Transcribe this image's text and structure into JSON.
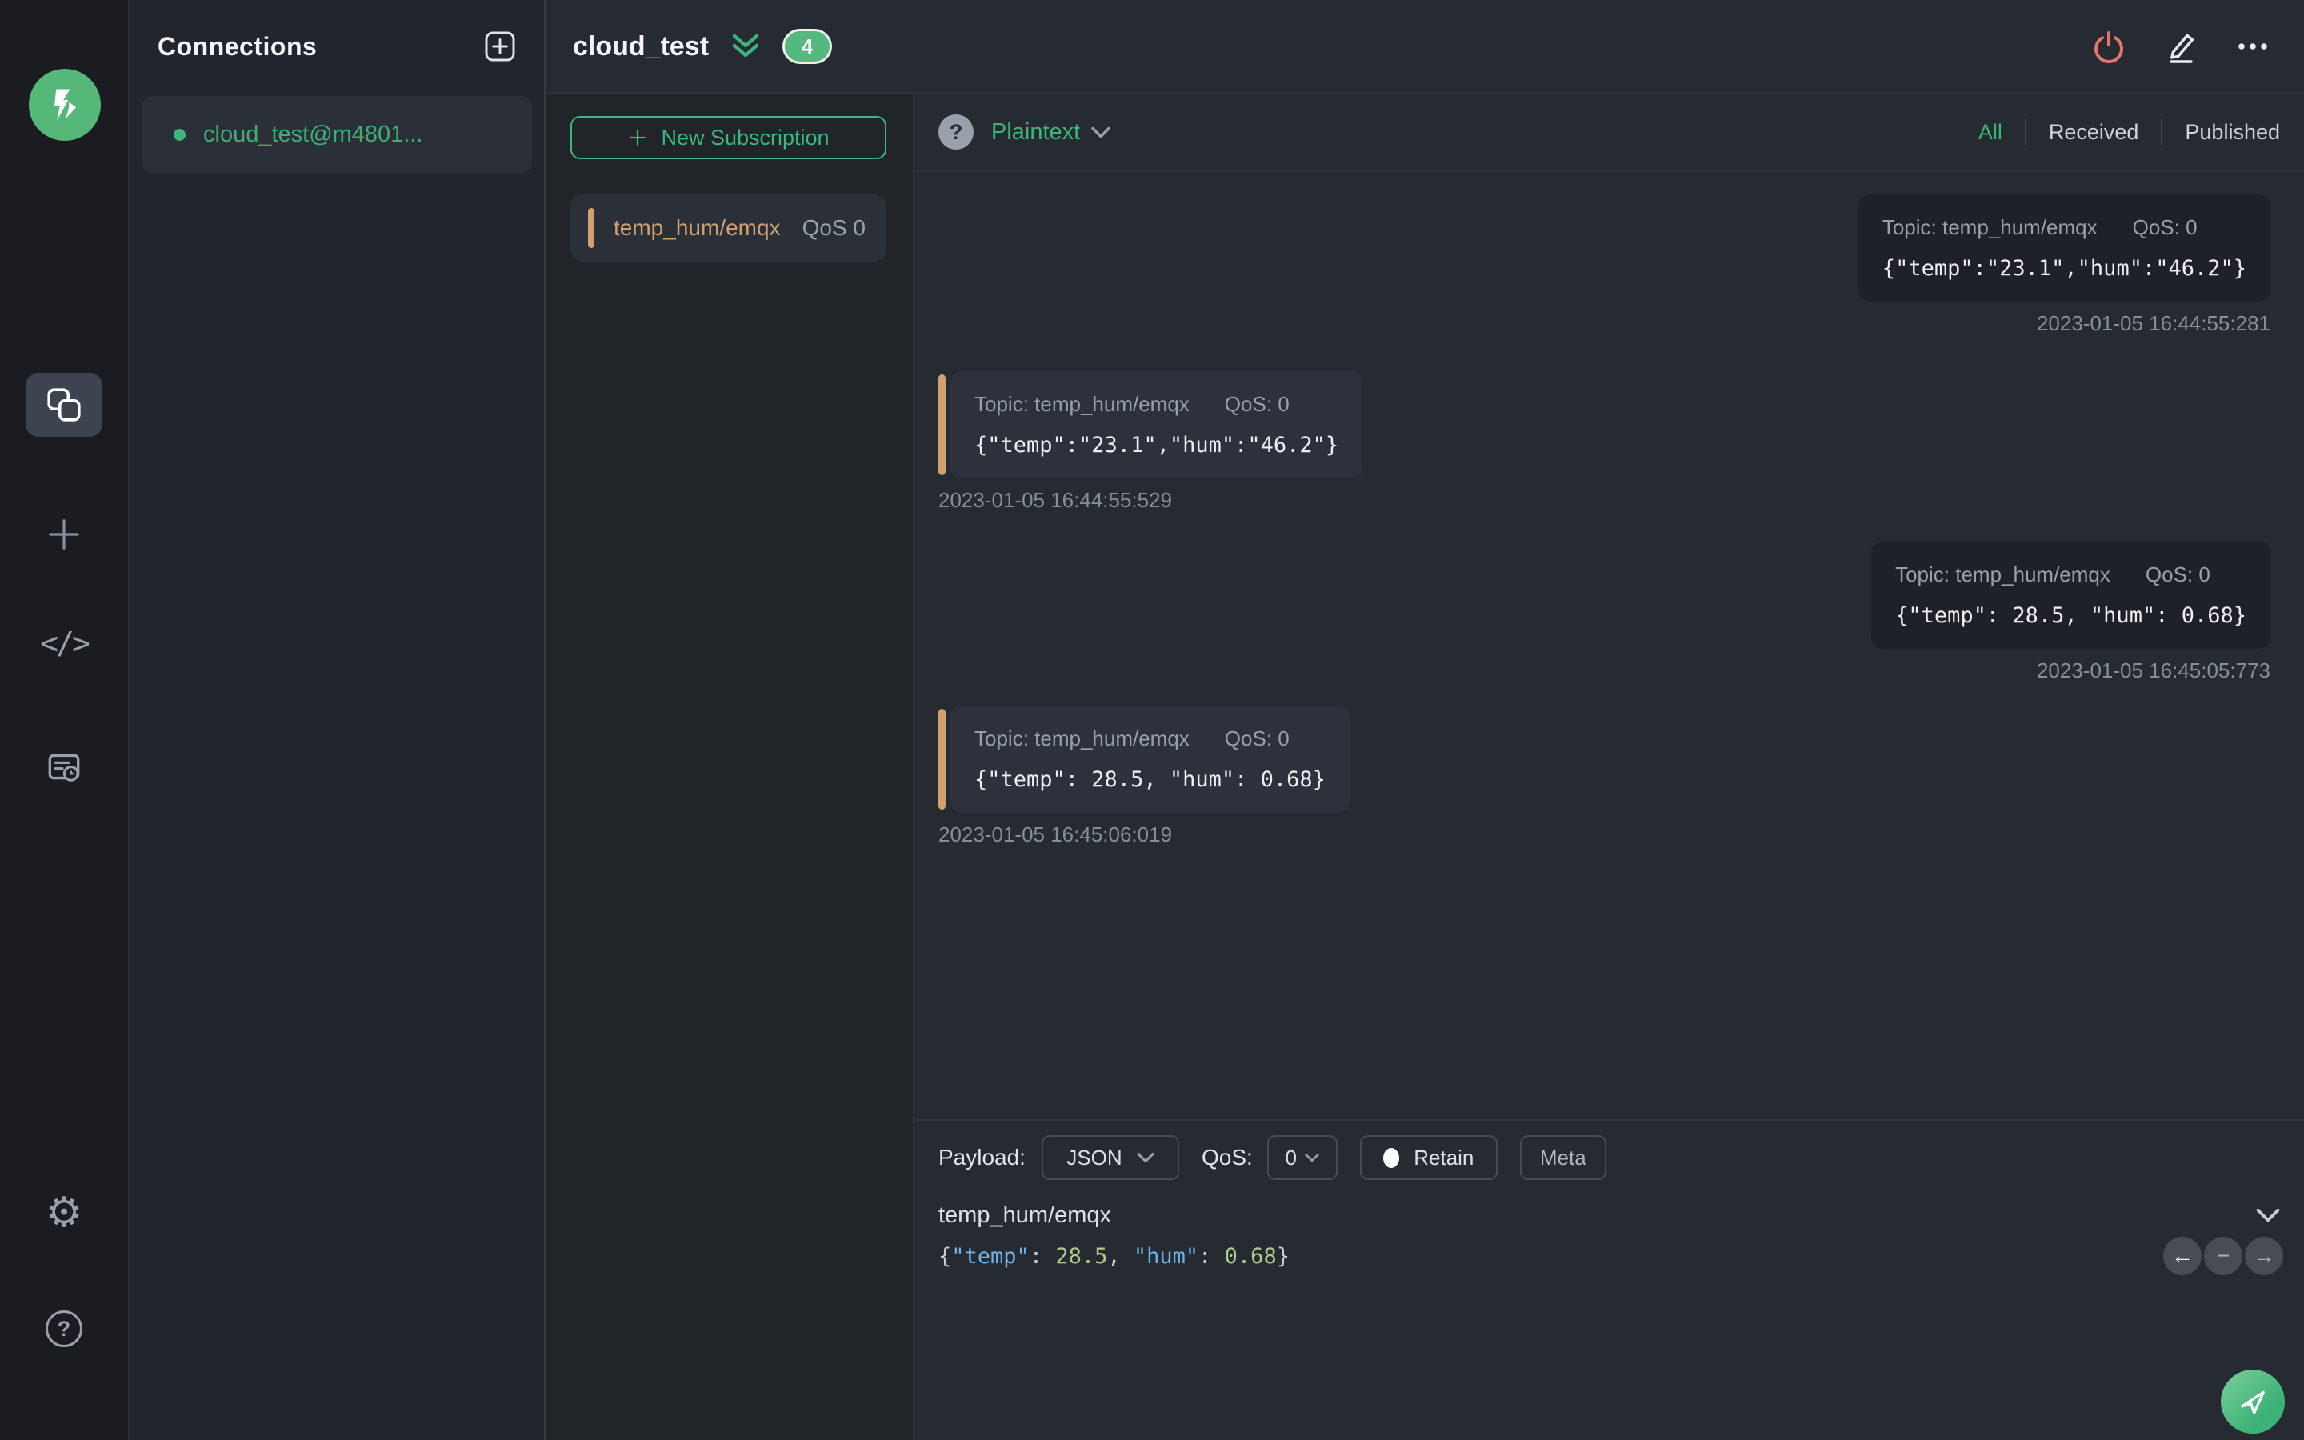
{
  "sidebar": {
    "logo_alt": "MQTTX",
    "nav": [
      {
        "name": "connections",
        "active": true
      },
      {
        "name": "new-connection",
        "active": false
      },
      {
        "name": "script",
        "active": false
      },
      {
        "name": "log",
        "active": false
      }
    ],
    "script_glyph": "</>",
    "gear_glyph": "⚙",
    "help_glyph": "?",
    "bottom": [
      {
        "name": "settings"
      },
      {
        "name": "help"
      }
    ]
  },
  "connections": {
    "title": "Connections",
    "items": [
      {
        "label": "cloud_test@m4801...",
        "connected": true
      }
    ]
  },
  "header": {
    "title": "cloud_test",
    "badge": "4"
  },
  "subscriptions": {
    "new_button": "New Subscription",
    "items": [
      {
        "topic": "temp_hum/emqx",
        "qos": "QoS 0"
      }
    ]
  },
  "toolbar": {
    "help_glyph": "?",
    "format": "Plaintext",
    "filters": [
      {
        "label": "All",
        "active": true
      },
      {
        "label": "Received",
        "active": false
      },
      {
        "label": "Published",
        "active": false
      }
    ]
  },
  "messages": {
    "items": [
      {
        "direction": "published",
        "topic_label": "Topic: temp_hum/emqx",
        "qos_label": "QoS: 0",
        "payload": "{\"temp\":\"23.1\",\"hum\":\"46.2\"}",
        "timestamp": "2023-01-05 16:44:55:281"
      },
      {
        "direction": "received",
        "topic_label": "Topic: temp_hum/emqx",
        "qos_label": "QoS: 0",
        "payload": "{\"temp\":\"23.1\",\"hum\":\"46.2\"}",
        "timestamp": "2023-01-05 16:44:55:529"
      },
      {
        "direction": "published",
        "topic_label": "Topic: temp_hum/emqx",
        "qos_label": "QoS: 0",
        "payload": "{\"temp\": 28.5, \"hum\": 0.68}",
        "timestamp": "2023-01-05 16:45:05:773"
      },
      {
        "direction": "received",
        "topic_label": "Topic: temp_hum/emqx",
        "qos_label": "QoS: 0",
        "payload": "{\"temp\": 28.5, \"hum\": 0.68}",
        "timestamp": "2023-01-05 16:45:06:019"
      }
    ]
  },
  "publish": {
    "payload_label": "Payload:",
    "format_value": "JSON",
    "qos_label": "QoS:",
    "qos_value": "0",
    "retain_label": "Retain",
    "meta_label": "Meta",
    "topic_value": "temp_hum/emqx",
    "nav_prev": "←",
    "nav_minus": "−",
    "nav_next": "→",
    "payload_tokens": [
      {
        "t": "{"
      },
      {
        "t": "\"temp\""
      },
      {
        "t": ": "
      },
      {
        "t": "28.5"
      },
      {
        "t": ", "
      },
      {
        "t": "\"hum\""
      },
      {
        "t": ": "
      },
      {
        "t": "0.68"
      },
      {
        "t": "}"
      }
    ]
  },
  "colors": {
    "accent_green": "#3db47c",
    "topic_orange": "#d2a06c",
    "power_red": "#e2756d",
    "json_key_blue": "#6fb1e6",
    "json_number_green": "#b0c98c"
  }
}
